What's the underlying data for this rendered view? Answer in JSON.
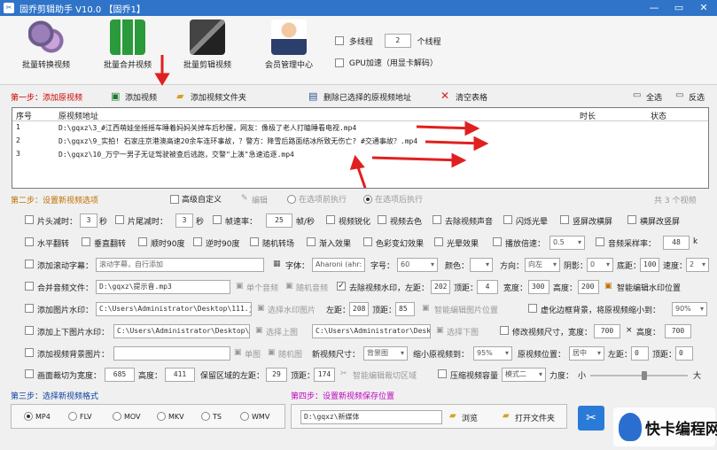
{
  "window": {
    "title": "固乔剪辑助手 V10.0 【固乔1】",
    "controls": [
      "—",
      "▭",
      "✕"
    ]
  },
  "toolbar": {
    "buttons": [
      {
        "label": "批量转换视频"
      },
      {
        "label": "批量合并视频"
      },
      {
        "label": "批量剪辑视频"
      },
      {
        "label": "会员管理中心"
      }
    ],
    "multithread_label": "多线程",
    "thread_count": "2",
    "thread_unit": "个线程",
    "gpu_label": "GPU加速（用显卡解码）"
  },
  "step1": {
    "title": "第一步：添加原视频",
    "add_video": "添加视频",
    "add_folder": "添加视频文件夹",
    "delete_selected": "删除已选择的原视频地址",
    "clear_table": "清空表格",
    "select_all": "全选",
    "invert": "反选"
  },
  "table": {
    "headers": [
      "序号",
      "原视频地址",
      "时长",
      "状态"
    ],
    "rows": [
      {
        "n": "1",
        "path": "D:\\gqxz\\3_#江西萌娃坐摇摇车睡着妈妈关掉车后秒醒，网友：像极了老人打瞌睡看电视.mp4"
      },
      {
        "n": "2",
        "path": "D:\\gqxz\\9_实拍! 石家庄京港澳高速20余车连环事故，？警方：降雪后路面结冰所致无伤亡? #交通事故？.mp4"
      },
      {
        "n": "3",
        "path": "D:\\gqxz\\10_万宁一男子无证驾驶被查后逃跑，交警\"上演\"急速追逐.mp4"
      }
    ]
  },
  "step2": {
    "title": "第二步：设置新视频选项",
    "advanced": "高级自定义",
    "edit": "编辑",
    "before": "在选项前执行",
    "after": "在选项后执行",
    "count": "共 3 个视频"
  },
  "r1": {
    "head_cut": "片头减时：",
    "head_val": "3",
    "sec1": "秒",
    "tail_cut": "片尾减时：",
    "tail_val": "3",
    "sec2": "秒",
    "frame": "帧速率：",
    "frame_val": "25",
    "frame_unit": "帧/秒",
    "sharpen": "视频锐化",
    "decolor": "视频去色",
    "remove_audio": "去除视频声音",
    "flash": "闪烁光晕",
    "portrait_blur": "竖屏改横屏",
    "landscape_blur": "横屏改竖屏"
  },
  "r2": {
    "hflip": "水平翻转",
    "vflip": "垂直翻转",
    "cw90": "顺时90度",
    "ccw90": "逆时90度",
    "random_fx": "随机转场",
    "fadein": "渐入效果",
    "color_fx": "色彩变幻效果",
    "light_fx": "光晕效果",
    "speed": "播放倍速：",
    "speed_val": "0.5",
    "sample": "音频采样率：",
    "sample_val": "48",
    "sample_unit": "k"
  },
  "r3": {
    "subtitle": "添加滚动字幕：",
    "subtitle_ph": "滚动字幕，自行添加",
    "font": "字体：",
    "font_val": "Aharoni (ahr:",
    "size": "字号：",
    "size_val": "60",
    "color": "颜色：",
    "dir": "方向：",
    "dir_val": "向左",
    "shadow": "阴影：",
    "shadow_val": "0",
    "bottom": "底距：",
    "bottom_val": "100",
    "speedlabel": "速度：",
    "speed_val": "2"
  },
  "r4": {
    "audio": "合并音频文件：",
    "audio_val": "D:\\gqxz\\提示音.mp3",
    "single": "单个音频",
    "random": "随机音频",
    "remove_wm": "去除视频水印，左距：",
    "left_val": "202",
    "top": "顶距：",
    "top_val": "4",
    "width": "宽度：",
    "width_val": "300",
    "height": "高度：",
    "height_val": "200",
    "smart_wm": "智能编辑水印位置"
  },
  "r5": {
    "img_wm": "添加图片水印：",
    "img_val": "C:\\Users\\Administrator\\Desktop\\111.j",
    "pick": "选择水印图片",
    "left": "左距：",
    "left_val": "208",
    "top": "顶距：",
    "top_val": "85",
    "smart": "智能编辑图片位置",
    "virtual": "虚化边框背景，将原视频缩小到：",
    "virtual_val": "90%"
  },
  "r6": {
    "tb_wm": "添加上下图片水印：",
    "top_path": "C:\\Users\\Administrator\\Desktop\\s",
    "pick_top": "选择上图",
    "bot_path": "C:\\Users\\Administrator\\Desk",
    "pick_bot": "选择下图",
    "resize": "修改视频尺寸，宽度：",
    "w_val": "700",
    "x": "×",
    "h_label": "高度：",
    "h_val": "700"
  },
  "r7": {
    "bg": "添加视频背景图片：",
    "single": "单图",
    "random": "随机图",
    "new_size": "新视频尺寸：",
    "new_size_val": "背景图",
    "shrink": "缩小原视频到：",
    "shrink_val": "95%",
    "pos": "原视频位置：",
    "pos_val": "居中",
    "left": "左距：",
    "left_val": "0",
    "top": "顶距：",
    "top_val": "0"
  },
  "r8": {
    "crop": "画面裁切为宽度：",
    "w_val": "685",
    "h": "高度：",
    "h_val": "411",
    "keep": "保留区域的左距：",
    "l_val": "29",
    "top": "顶距：",
    "t_val": "174",
    "smart": "智能编辑裁切区域",
    "compress": "压缩视频容量",
    "mode_val": "模式二",
    "strength": "力度：",
    "small": "小",
    "big": "大"
  },
  "step3": {
    "title": "第三步：选择新视频格式",
    "formats": [
      "MP4",
      "FLV",
      "MOV",
      "MKV",
      "TS",
      "WMV"
    ]
  },
  "step4": {
    "title": "第四步：设置新视频保存位置",
    "path": "D:\\gqxz\\新媒体",
    "browse": "浏览",
    "open": "打开文件夹"
  },
  "watermark": {
    "text": "快卡编程网"
  },
  "colors": {
    "title_bar": "#2f74c8",
    "arrow": "#e02020",
    "step1": "#cc0000",
    "step3": "#0a3fa0",
    "step4": "#c000c0"
  }
}
